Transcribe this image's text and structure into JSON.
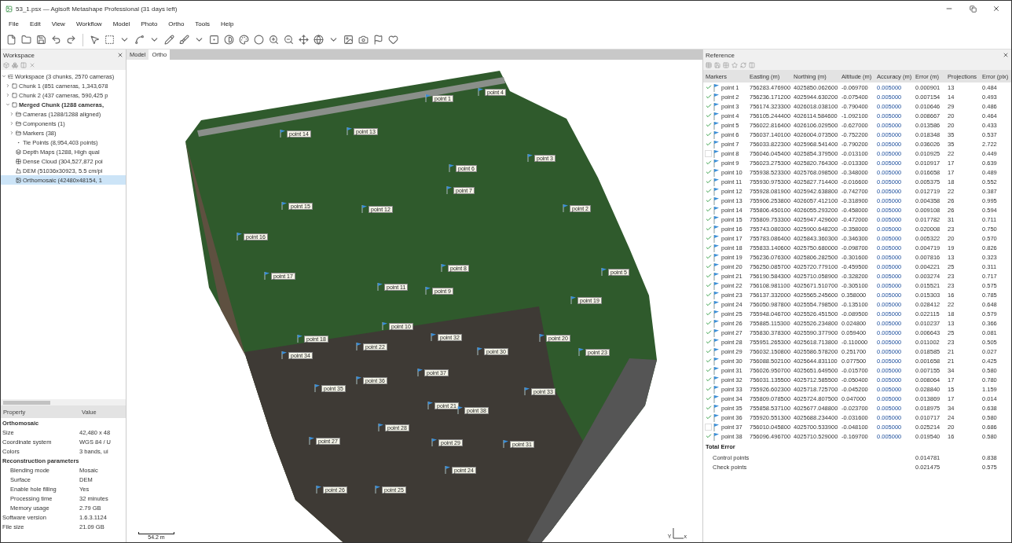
{
  "window": {
    "title": "53_1.psx — Agisoft Metashape Professional (31 days left)"
  },
  "menu": [
    "File",
    "Edit",
    "View",
    "Workflow",
    "Model",
    "Photo",
    "Ortho",
    "Tools",
    "Help"
  ],
  "workspace": {
    "title": "Workspace",
    "tree": [
      {
        "label": "Workspace (3 chunks, 2570 cameras)",
        "kind": "workspace",
        "expanded": true,
        "selected": false,
        "bold": false,
        "children": [
          {
            "label": "Chunk 1 (851 cameras, 1,343,678",
            "kind": "chunk",
            "expanded": false,
            "selected": false,
            "bold": false
          },
          {
            "label": "Chunk 2 (437 cameras, 590,425 p",
            "kind": "chunk",
            "expanded": false,
            "selected": false,
            "bold": false
          },
          {
            "label": "Merged Chunk (1288 cameras,",
            "kind": "chunk",
            "expanded": true,
            "selected": false,
            "bold": true,
            "children": [
              {
                "label": "Cameras (1288/1288 aligned)",
                "kind": "folder",
                "expanded": false,
                "selected": false,
                "bold": false
              },
              {
                "label": "Components (1)",
                "kind": "folder",
                "expanded": false,
                "selected": false,
                "bold": false
              },
              {
                "label": "Markers (38)",
                "kind": "folder",
                "expanded": false,
                "selected": false,
                "bold": false
              },
              {
                "label": "Tie Points (8,954,403 points)",
                "kind": "points",
                "selected": false,
                "bold": false
              },
              {
                "label": "Depth Maps (1288, High qual",
                "kind": "depth",
                "selected": false,
                "bold": false
              },
              {
                "label": "Dense Cloud (304,527,872 poi",
                "kind": "dense",
                "selected": false,
                "bold": false
              },
              {
                "label": "DEM (51036x30923, 5.5 cm/pi",
                "kind": "dem",
                "selected": false,
                "bold": false
              },
              {
                "label": "Orthomosaic (42480x48154, 1",
                "kind": "ortho",
                "selected": true,
                "bold": false
              }
            ]
          }
        ]
      }
    ]
  },
  "properties": {
    "columns": [
      "Property",
      "Value"
    ],
    "rows": [
      {
        "kind": "section",
        "name": "Orthomosaic"
      },
      {
        "kind": "row",
        "name": "Size",
        "value": "42,480 x 48"
      },
      {
        "kind": "row",
        "name": "Coordinate system",
        "value": "WGS 84 / U"
      },
      {
        "kind": "row",
        "name": "Colors",
        "value": "3 bands, ui"
      },
      {
        "kind": "section",
        "name": "Reconstruction parameters"
      },
      {
        "kind": "sub",
        "name": "Blending mode",
        "value": "Mosaic"
      },
      {
        "kind": "sub",
        "name": "Surface",
        "value": "DEM"
      },
      {
        "kind": "sub",
        "name": "Enable hole filling",
        "value": "Yes"
      },
      {
        "kind": "sub",
        "name": "Processing time",
        "value": "32 minutes"
      },
      {
        "kind": "sub",
        "name": "Memory usage",
        "value": "2.79 GB"
      },
      {
        "kind": "row",
        "name": "Software version",
        "value": "1.6.3.1124"
      },
      {
        "kind": "row",
        "name": "File size",
        "value": "21.09 GB"
      }
    ]
  },
  "view": {
    "tabs": [
      {
        "label": "Model",
        "selected": false
      },
      {
        "label": "Ortho",
        "selected": true
      }
    ],
    "markers": [
      {
        "label": "point 1"
      },
      {
        "label": "point 4"
      },
      {
        "label": "point 14"
      },
      {
        "label": "point 13"
      },
      {
        "label": "point 3"
      },
      {
        "label": "point 6"
      },
      {
        "label": "point 7"
      },
      {
        "label": "point 15"
      },
      {
        "label": "point 12"
      },
      {
        "label": "point 2"
      },
      {
        "label": "point 16"
      },
      {
        "label": "point 8"
      },
      {
        "label": "point 5"
      },
      {
        "label": "point 17"
      },
      {
        "label": "point 11"
      },
      {
        "label": "point 9"
      },
      {
        "label": "point 19"
      },
      {
        "label": "point 10"
      },
      {
        "label": "point 18"
      },
      {
        "label": "point 32"
      },
      {
        "label": "point 20"
      },
      {
        "label": "point 22"
      },
      {
        "label": "point 30"
      },
      {
        "label": "point 23"
      },
      {
        "label": "point 34"
      },
      {
        "label": "point 37"
      },
      {
        "label": "point 36"
      },
      {
        "label": "point 35"
      },
      {
        "label": "point 33"
      },
      {
        "label": "point 21"
      },
      {
        "label": "point 38"
      },
      {
        "label": "point 28"
      },
      {
        "label": "point 27"
      },
      {
        "label": "point 29"
      },
      {
        "label": "point 31"
      },
      {
        "label": "point 24"
      },
      {
        "label": "point 26"
      },
      {
        "label": "point 25"
      }
    ],
    "scale": "54.2 m",
    "axis_y": "Y",
    "axis_x": "x"
  },
  "reference": {
    "title": "Reference",
    "columns": [
      "Markers",
      "Easting (m)",
      "Northing (m)",
      "Altitude (m)",
      "Accuracy (m)",
      "Error (m)",
      "Projections",
      "Error (pix)"
    ],
    "rows": [
      {
        "checked": true,
        "cells": [
          "point 1",
          "756283.476900",
          "4025850.062600",
          "-0.069700",
          "0.005000",
          "0.000901",
          "13",
          "0.484"
        ]
      },
      {
        "checked": true,
        "cells": [
          "point 2",
          "756236.171200",
          "4025944.630200",
          "-0.075400",
          "0.005000",
          "0.007154",
          "14",
          "0.493"
        ]
      },
      {
        "checked": true,
        "cells": [
          "point 3",
          "756174.323300",
          "4026018.038100",
          "-0.790400",
          "0.005000",
          "0.010646",
          "29",
          "0.486"
        ]
      },
      {
        "checked": true,
        "cells": [
          "point 4",
          "756105.244400",
          "4026114.584600",
          "-1.092100",
          "0.005000",
          "0.008667",
          "20",
          "0.464"
        ]
      },
      {
        "checked": true,
        "cells": [
          "point 5",
          "756022.816400",
          "4026106.029500",
          "-0.627000",
          "0.005000",
          "0.013586",
          "20",
          "0.433"
        ]
      },
      {
        "checked": true,
        "cells": [
          "point 6",
          "756037.140100",
          "4026004.073500",
          "-0.752200",
          "0.005000",
          "0.018348",
          "35",
          "0.537"
        ]
      },
      {
        "checked": true,
        "cells": [
          "point 7",
          "756033.822300",
          "4025968.541400",
          "-0.790200",
          "0.005000",
          "0.036026",
          "35",
          "2.722"
        ]
      },
      {
        "checked": false,
        "cells": [
          "point 8",
          "756046.045400",
          "4025854.379500",
          "-0.013100",
          "0.005000",
          "0.010925",
          "22",
          "0.449"
        ]
      },
      {
        "checked": true,
        "cells": [
          "point 9",
          "756023.275300",
          "4025820.764300",
          "-0.013300",
          "0.005000",
          "0.010917",
          "17",
          "0.639"
        ]
      },
      {
        "checked": true,
        "cells": [
          "point 10",
          "755938.523300",
          "4025768.098500",
          "-0.348000",
          "0.005000",
          "0.016658",
          "17",
          "0.489"
        ]
      },
      {
        "checked": true,
        "cells": [
          "point 11",
          "755930.975300",
          "4025827.714400",
          "-0.016600",
          "0.005000",
          "0.005375",
          "18",
          "0.552"
        ]
      },
      {
        "checked": true,
        "cells": [
          "point 12",
          "755928.081900",
          "4025942.638800",
          "-0.742700",
          "0.005000",
          "0.012719",
          "22",
          "0.387"
        ]
      },
      {
        "checked": true,
        "cells": [
          "point 13",
          "755906.253800",
          "4026057.412100",
          "-0.318900",
          "0.005000",
          "0.004358",
          "26",
          "0.995"
        ]
      },
      {
        "checked": true,
        "cells": [
          "point 14",
          "755806.450100",
          "4026055.293200",
          "-0.458000",
          "0.005000",
          "0.009108",
          "26",
          "0.594"
        ]
      },
      {
        "checked": true,
        "cells": [
          "point 15",
          "755809.753300",
          "4025947.429600",
          "-0.472000",
          "0.005000",
          "0.017782",
          "31",
          "0.711"
        ]
      },
      {
        "checked": true,
        "cells": [
          "point 16",
          "755743.080300",
          "4025900.648200",
          "-0.358000",
          "0.005000",
          "0.020008",
          "23",
          "0.750"
        ]
      },
      {
        "checked": true,
        "cells": [
          "point 17",
          "755783.086400",
          "4025843.360300",
          "-0.346300",
          "0.005000",
          "0.005322",
          "20",
          "0.570"
        ]
      },
      {
        "checked": true,
        "cells": [
          "point 18",
          "755833.140600",
          "4025750.680000",
          "-0.098700",
          "0.005000",
          "0.004719",
          "19",
          "0.826"
        ]
      },
      {
        "checked": true,
        "cells": [
          "point 19",
          "756236.076300",
          "4025806.282500",
          "-0.301600",
          "0.005000",
          "0.007816",
          "13",
          "0.323"
        ]
      },
      {
        "checked": true,
        "cells": [
          "point 20",
          "756250.085700",
          "4025720.779100",
          "-0.459500",
          "0.005000",
          "0.004221",
          "25",
          "0.311"
        ]
      },
      {
        "checked": true,
        "cells": [
          "point 21",
          "756190.584300",
          "4025710.058900",
          "-0.328200",
          "0.005000",
          "0.003274",
          "23",
          "0.717"
        ]
      },
      {
        "checked": true,
        "cells": [
          "point 22",
          "756108.981100",
          "4025671.510700",
          "-0.305100",
          "0.005000",
          "0.015521",
          "23",
          "0.575"
        ]
      },
      {
        "checked": true,
        "cells": [
          "point 23",
          "756137.332000",
          "4025565.245600",
          "0.358000",
          "0.005000",
          "0.015303",
          "16",
          "0.785"
        ]
      },
      {
        "checked": true,
        "cells": [
          "point 24",
          "756050.987800",
          "4025554.798500",
          "-0.135100",
          "0.005000",
          "0.028412",
          "22",
          "0.648"
        ]
      },
      {
        "checked": true,
        "cells": [
          "point 25",
          "755948.046700",
          "4025526.451500",
          "-0.089500",
          "0.005000",
          "0.022115",
          "18",
          "0.579"
        ]
      },
      {
        "checked": true,
        "cells": [
          "point 26",
          "755885.115300",
          "4025526.234800",
          "0.024800",
          "0.005000",
          "0.010237",
          "13",
          "0.366"
        ]
      },
      {
        "checked": true,
        "cells": [
          "point 27",
          "755830.378300",
          "4025590.377900",
          "0.059400",
          "0.005000",
          "0.006643",
          "25",
          "0.081"
        ]
      },
      {
        "checked": true,
        "cells": [
          "point 28",
          "755951.265300",
          "4025618.713800",
          "-0.110000",
          "0.005000",
          "0.011002",
          "23",
          "0.505"
        ]
      },
      {
        "checked": true,
        "cells": [
          "point 29",
          "756032.150800",
          "4025586.578200",
          "0.251700",
          "0.005000",
          "0.018585",
          "21",
          "0.027"
        ]
      },
      {
        "checked": true,
        "cells": [
          "point 30",
          "756088.502100",
          "4025644.831100",
          "0.077500",
          "0.005000",
          "0.001658",
          "21",
          "0.425"
        ]
      },
      {
        "checked": true,
        "cells": [
          "point 31",
          "756026.950700",
          "4025651.649500",
          "-0.015700",
          "0.005000",
          "0.007155",
          "34",
          "0.580"
        ]
      },
      {
        "checked": true,
        "cells": [
          "point 32",
          "756031.135500",
          "4025712.585500",
          "-0.050400",
          "0.005000",
          "0.008064",
          "17",
          "0.780"
        ]
      },
      {
        "checked": true,
        "cells": [
          "point 33",
          "755926.602300",
          "4025718.725700",
          "-0.045200",
          "0.005000",
          "0.028840",
          "15",
          "1.159"
        ]
      },
      {
        "checked": true,
        "cells": [
          "point 34",
          "755809.078500",
          "4025724.807500",
          "0.047000",
          "0.005000",
          "0.013869",
          "17",
          "0.014"
        ]
      },
      {
        "checked": true,
        "cells": [
          "point 35",
          "755858.537100",
          "4025677.048800",
          "-0.023700",
          "0.005000",
          "0.018975",
          "34",
          "0.638"
        ]
      },
      {
        "checked": true,
        "cells": [
          "point 36",
          "755920.551300",
          "4025688.234400",
          "-0.031600",
          "0.005000",
          "0.010717",
          "24",
          "0.580"
        ]
      },
      {
        "checked": false,
        "cells": [
          "point 37",
          "756010.045800",
          "4025700.533900",
          "-0.048100",
          "0.005000",
          "0.025214",
          "20",
          "0.686"
        ]
      },
      {
        "checked": true,
        "cells": [
          "point 38",
          "756096.496700",
          "4025710.529000",
          "-0.169700",
          "0.005000",
          "0.019540",
          "16",
          "0.580"
        ]
      }
    ],
    "total_title": "Total Error",
    "totals": [
      {
        "label": "Control points",
        "error": "0.014781",
        "error_pix": "0.838"
      },
      {
        "label": "Check points",
        "error": "0.021475",
        "error_pix": "0.575"
      }
    ]
  }
}
